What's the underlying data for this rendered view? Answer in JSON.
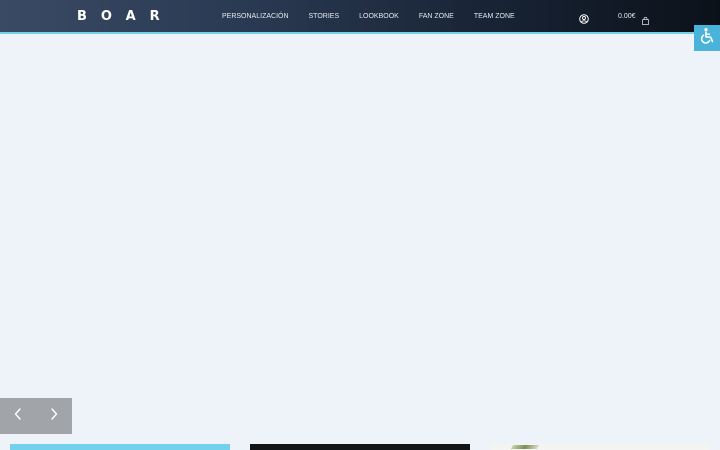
{
  "brand": {
    "logo_text": "BOAR"
  },
  "nav": {
    "items": [
      {
        "label": "PERSONALIZACIÓN"
      },
      {
        "label": "STORIES"
      },
      {
        "label": "LOOKBOOK"
      },
      {
        "label": "FAN ZONE"
      },
      {
        "label": "TEAM ZONE"
      }
    ]
  },
  "cart": {
    "total": "0.00€"
  },
  "icons": {
    "account": "user-circle-icon",
    "cart": "shopping-bag-icon",
    "accessibility": "wheelchair-icon",
    "prev": "chevron-left-icon",
    "next": "chevron-right-icon"
  },
  "colors": {
    "header_dark": "#0b1119",
    "header_light": "#3a4a64",
    "accent": "#6fd3ea",
    "page_background": "#eef2f9",
    "accessibility_button": "#49b3d9",
    "slider_controls": "#a1a4a8"
  }
}
